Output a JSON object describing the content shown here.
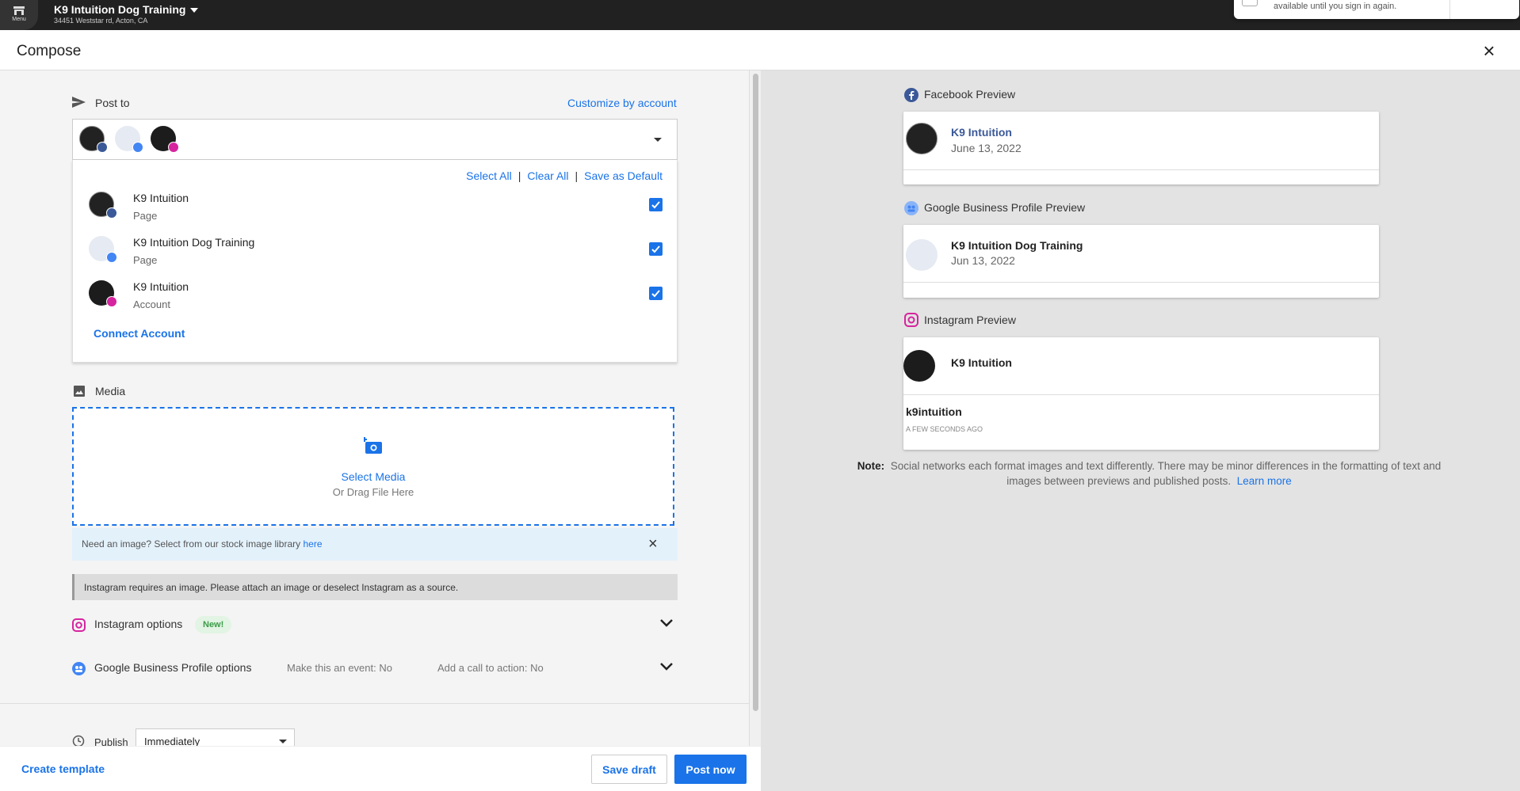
{
  "topbar": {
    "menu_label": "Menu",
    "business_name": "K9 Intuition Dog Training",
    "business_address": "34451 Weststar rd, Acton, CA",
    "toast_text": "available until you sign in again."
  },
  "compose": {
    "title": "Compose",
    "close_label": "×"
  },
  "post_to": {
    "label": "Post to",
    "customize_link": "Customize by account",
    "actions": {
      "select_all": "Select All",
      "clear_all": "Clear All",
      "save_default": "Save as Default",
      "separator": "|"
    },
    "accounts": [
      {
        "name": "K9 Intuition",
        "type": "Page",
        "network": "facebook-icon",
        "checked": true
      },
      {
        "name": "K9 Intuition Dog Training",
        "type": "Page",
        "network": "google-business-icon",
        "checked": true
      },
      {
        "name": "K9 Intuition",
        "type": "Account",
        "network": "instagram-icon",
        "checked": true
      }
    ],
    "connect_account": "Connect Account"
  },
  "media": {
    "label": "Media",
    "select_media": "Select Media",
    "drag_hint": "Or Drag File Here",
    "stock_prompt": "Need an image? Select from our stock image library",
    "stock_link": "here",
    "stock_close": "×",
    "instagram_warning": "Instagram requires an image. Please attach an image or deselect Instagram as a source."
  },
  "options": {
    "instagram_label": "Instagram options",
    "instagram_badge": "New!",
    "gbp_label": "Google Business Profile options",
    "gbp_event": "Make this an event: No",
    "gbp_cta": "Add a call to action: No"
  },
  "publish": {
    "label": "Publish",
    "value": "Immediately"
  },
  "footer": {
    "create_template": "Create template",
    "save_draft": "Save draft",
    "post_now": "Post now"
  },
  "previews": {
    "facebook": {
      "title": "Facebook Preview",
      "name": "K9 Intuition",
      "date": "June 13, 2022"
    },
    "gbp": {
      "title": "Google Business Profile Preview",
      "name": "K9 Intuition Dog Training",
      "date": "Jun 13, 2022"
    },
    "instagram": {
      "title": "Instagram Preview",
      "name": "K9 Intuition",
      "handle": "k9intuition",
      "time": "A FEW SECONDS AGO"
    },
    "note_label": "Note:",
    "note_text": "Social networks each format images and text differently. There may be minor differences in the formatting of text and images between previews and published posts.",
    "learn_more": "Learn more"
  },
  "colors": {
    "accent": "#1a73e8",
    "topbar": "#212121",
    "facebook": "#3b5998",
    "gbp": "#4285f4"
  }
}
